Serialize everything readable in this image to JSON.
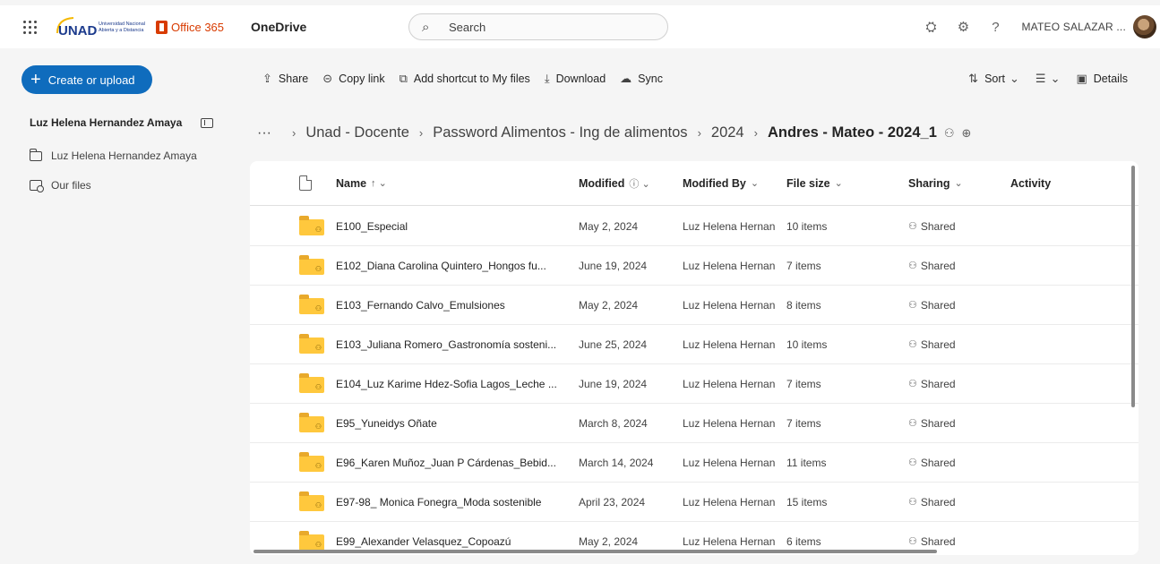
{
  "header": {
    "org_logo_text": "UNAD",
    "org_logo_subtext": "Universidad Nacional Abierta y a Distancia",
    "suite_name": "Office 365",
    "app_name": "OneDrive",
    "search_placeholder": "Search",
    "user_name": "MATEO SALAZAR ...",
    "help_glyph": "?"
  },
  "sidebar": {
    "create_label": "Create or upload",
    "library_title": "Luz Helena Hernandez Amaya",
    "items": [
      {
        "label": "Luz Helena Hernandez Amaya",
        "icon": "folder-icon"
      },
      {
        "label": "Our files",
        "icon": "our-files-icon"
      }
    ]
  },
  "commands": {
    "share": "Share",
    "copy_link": "Copy link",
    "add_shortcut": "Add shortcut to My files",
    "download": "Download",
    "sync": "Sync",
    "sort": "Sort",
    "details": "Details"
  },
  "breadcrumb": {
    "more": "···",
    "items": [
      "Unad - Docente",
      "Password Alimentos - Ing de alimentos",
      "2024"
    ],
    "current": "Andres - Mateo - 2024_1"
  },
  "table": {
    "columns": {
      "name": "Name",
      "modified": "Modified",
      "modified_by": "Modified By",
      "file_size": "File size",
      "sharing": "Sharing",
      "activity": "Activity"
    },
    "rows": [
      {
        "name": "E100_Especial",
        "modified": "May 2, 2024",
        "modified_by": "Luz Helena Hernan",
        "size": "10 items",
        "sharing": "Shared"
      },
      {
        "name": "E102_Diana Carolina Quintero_Hongos fu...",
        "modified": "June 19, 2024",
        "modified_by": "Luz Helena Hernan",
        "size": "7 items",
        "sharing": "Shared"
      },
      {
        "name": "E103_Fernando Calvo_Emulsiones",
        "modified": "May 2, 2024",
        "modified_by": "Luz Helena Hernan",
        "size": "8 items",
        "sharing": "Shared"
      },
      {
        "name": "E103_Juliana Romero_Gastronomía sosteni...",
        "modified": "June 25, 2024",
        "modified_by": "Luz Helena Hernan",
        "size": "10 items",
        "sharing": "Shared"
      },
      {
        "name": "E104_Luz Karime Hdez-Sofia Lagos_Leche ...",
        "modified": "June 19, 2024",
        "modified_by": "Luz Helena Hernan",
        "size": "7 items",
        "sharing": "Shared"
      },
      {
        "name": "E95_Yuneidys Oñate",
        "modified": "March 8, 2024",
        "modified_by": "Luz Helena Hernan",
        "size": "7 items",
        "sharing": "Shared"
      },
      {
        "name": "E96_Karen Muñoz_Juan P Cárdenas_Bebid...",
        "modified": "March 14, 2024",
        "modified_by": "Luz Helena Hernan",
        "size": "11 items",
        "sharing": "Shared"
      },
      {
        "name": "E97-98_ Monica Fonegra_Moda sostenible",
        "modified": "April 23, 2024",
        "modified_by": "Luz Helena Hernan",
        "size": "15 items",
        "sharing": "Shared"
      },
      {
        "name": "E99_Alexander Velasquez_Copoazú",
        "modified": "May 2, 2024",
        "modified_by": "Luz Helena Hernan",
        "size": "6 items",
        "sharing": "Shared"
      }
    ]
  },
  "colors": {
    "accent": "#0f6cbd",
    "folder": "#ffc83d",
    "office_brand": "#d83b01",
    "unad_blue": "#1b3a8c",
    "unad_gold": "#f5b800"
  }
}
